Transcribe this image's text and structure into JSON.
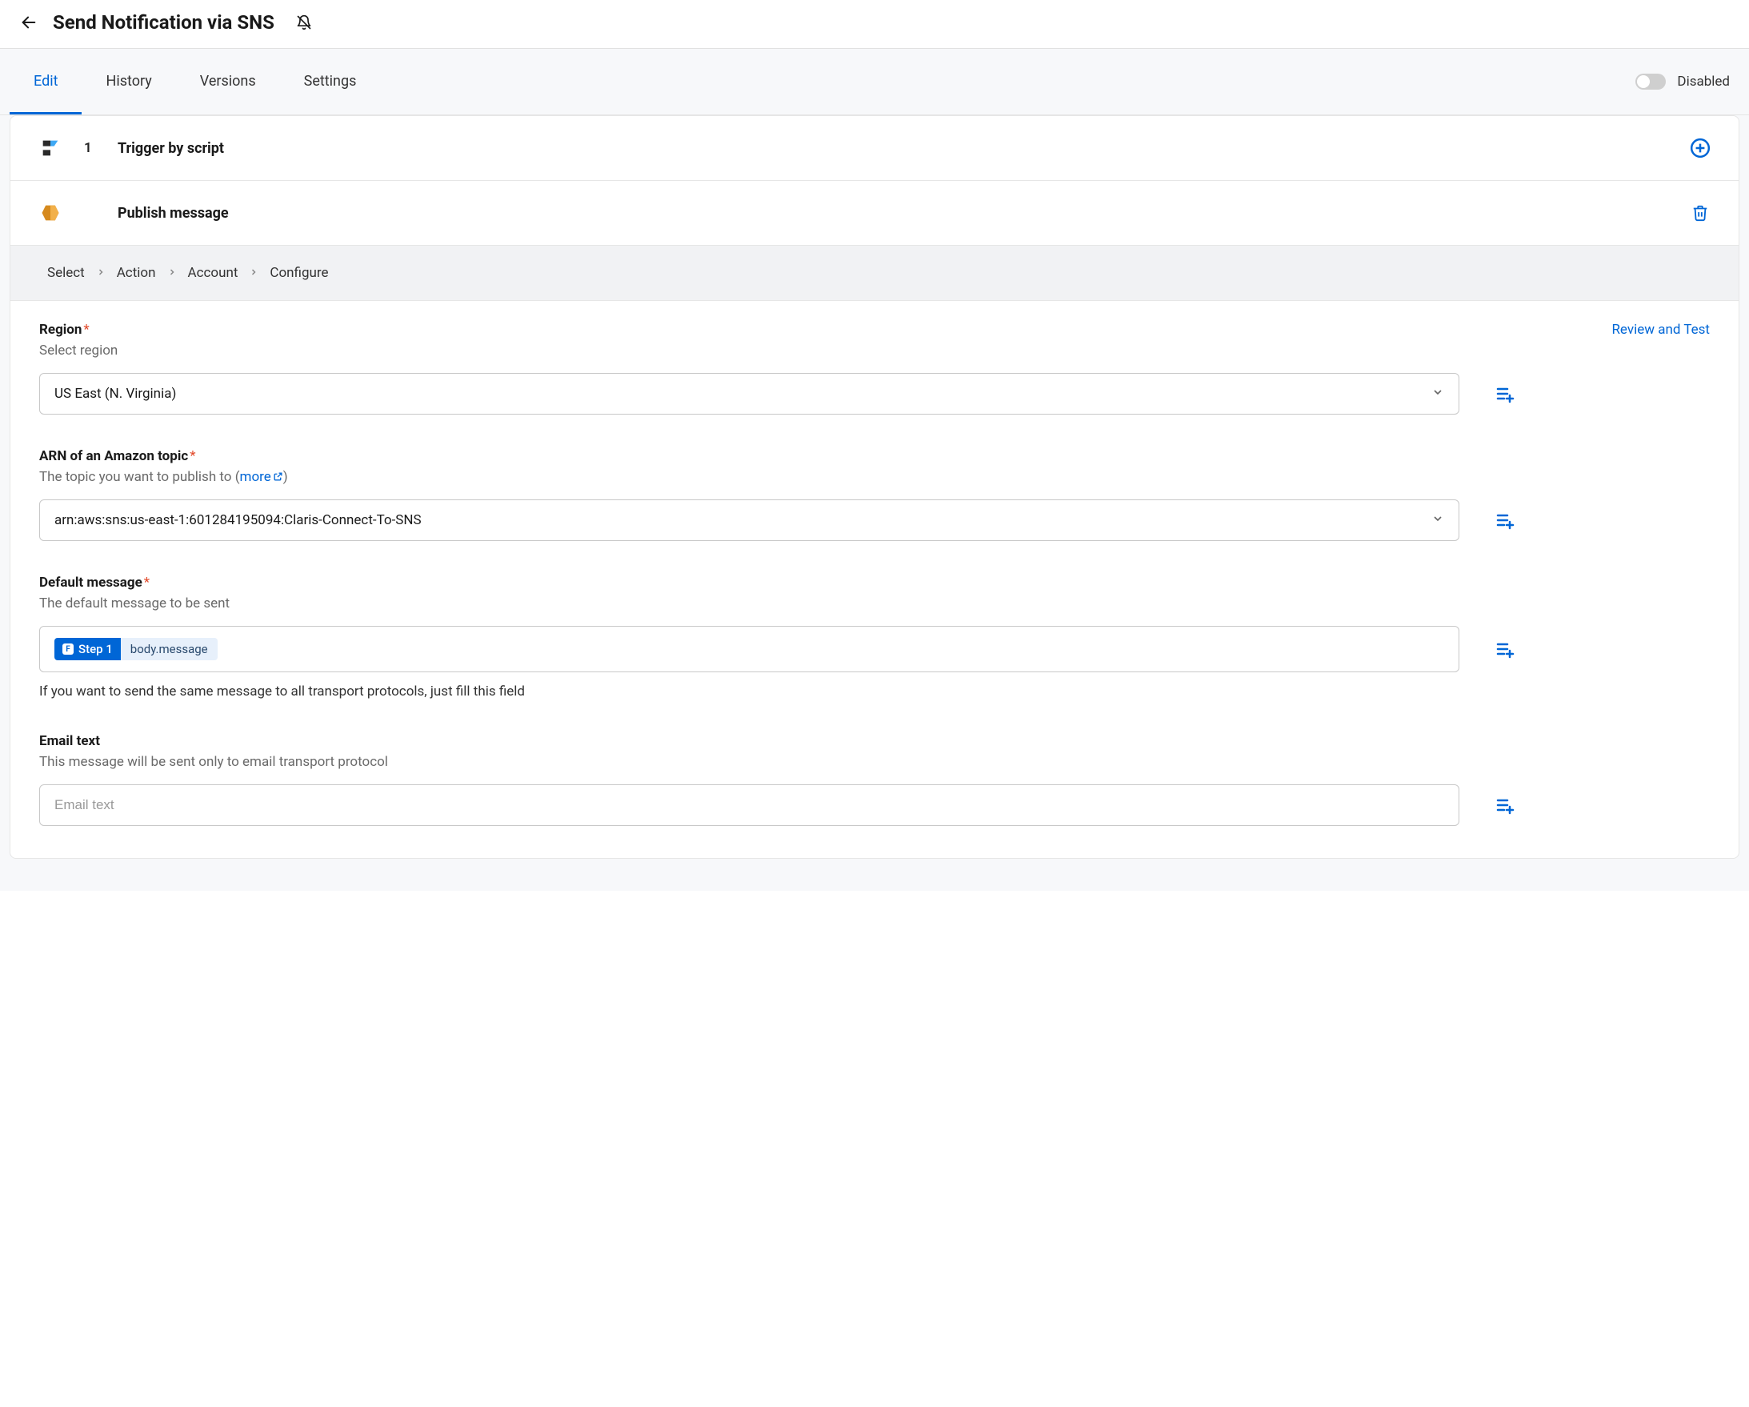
{
  "header": {
    "title": "Send Notification via SNS"
  },
  "tabs": {
    "items": [
      "Edit",
      "History",
      "Versions",
      "Settings"
    ],
    "active_index": 0
  },
  "toggle": {
    "label": "Disabled",
    "on": false
  },
  "steps": {
    "trigger": {
      "number": "1",
      "title": "Trigger by script"
    },
    "action": {
      "title": "Publish message"
    }
  },
  "breadcrumbs": [
    "Select",
    "Action",
    "Account",
    "Configure"
  ],
  "review_link": "Review and Test",
  "fields": {
    "region": {
      "label": "Region",
      "required": true,
      "help": "Select region",
      "value": "US East (N. Virginia)"
    },
    "arn": {
      "label": "ARN of an Amazon topic",
      "required": true,
      "help_prefix": "The topic you want to publish to (",
      "help_link": "more",
      "help_suffix": ")",
      "value": "arn:aws:sns:us-east-1:601284195094:Claris-Connect-To-SNS"
    },
    "default_message": {
      "label": "Default message",
      "required": true,
      "help": "The default message to be sent",
      "pill_step": "Step 1",
      "pill_path": "body.message",
      "note": "If you want to send the same message to all transport protocols, just fill this field"
    },
    "email_text": {
      "label": "Email text",
      "required": false,
      "help": "This message will be sent only to email transport protocol",
      "placeholder": "Email text"
    }
  }
}
